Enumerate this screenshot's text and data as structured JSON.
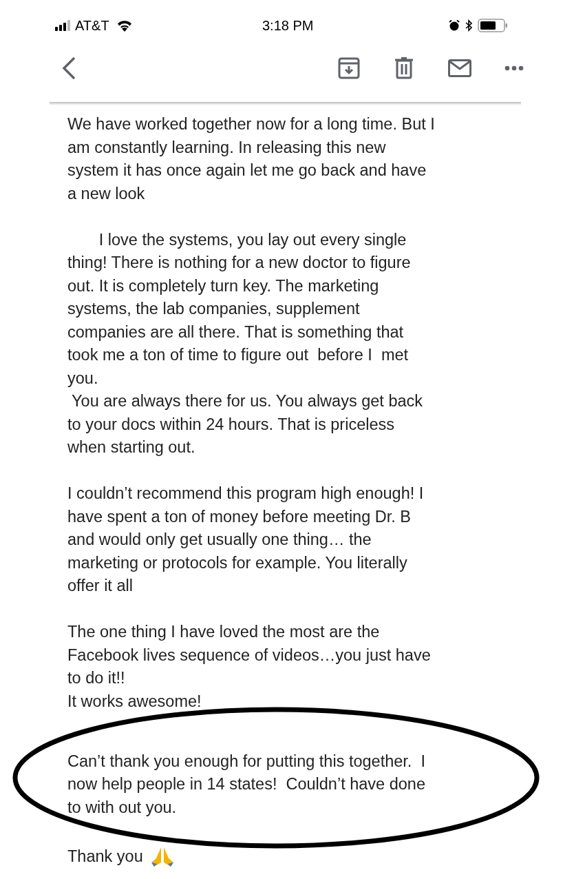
{
  "status_bar": {
    "carrier": "AT&T",
    "time": "3:18 PM"
  },
  "paragraphs": [
    {
      "lines": [
        "We have worked together now for a long time. But I",
        "am constantly learning. In releasing this new",
        "system it has once again let me go back and have",
        "a new look"
      ]
    },
    {
      "lines": [
        "       I love the systems, you lay out every single",
        "thing! There is nothing for a new doctor to figure",
        "out. It is completely turn key. The marketing",
        "systems, the lab companies, supplement",
        "companies are all there. That is something that",
        "took me a ton of time to figure out  before I  met",
        "you.",
        " You are always there for us. You always get back",
        "to your docs within 24 hours. That is priceless",
        "when starting out."
      ]
    },
    {
      "lines": [
        "I couldn’t recommend this program high enough! I",
        "have spent a ton of money before meeting Dr. B",
        "and would only get usually one thing… the",
        "marketing or protocols for example. You literally",
        "offer it all"
      ]
    },
    {
      "lines": [
        "The one thing I have loved the most are the",
        "Facebook lives sequence of videos…you just have",
        "to do it!!",
        "It works awesome!"
      ]
    },
    {
      "lines": [
        "Can’t thank you enough for putting this together.  I",
        "now help people in 14 states!  Couldn’t have done",
        "to with out you."
      ],
      "circled": true
    }
  ],
  "closing": "Thank you"
}
